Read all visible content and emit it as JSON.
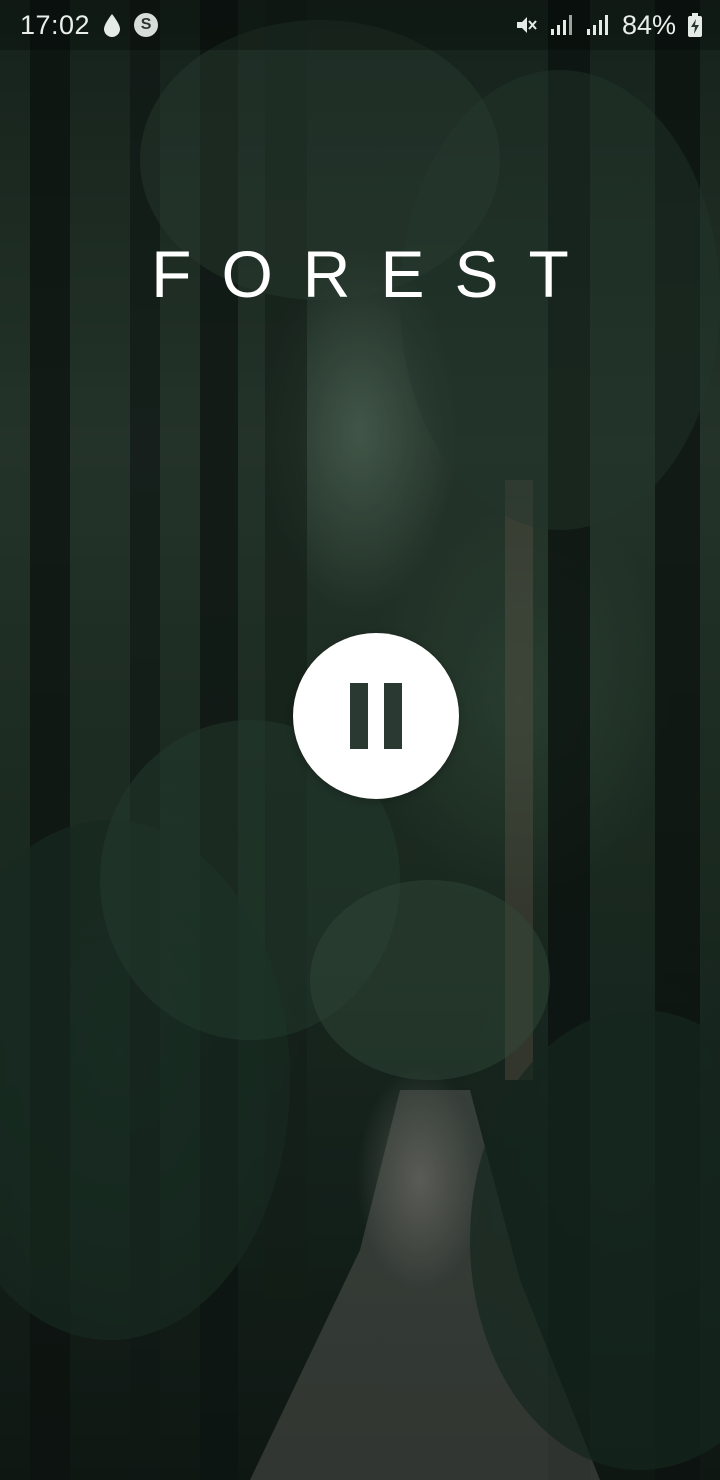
{
  "status_bar": {
    "time": "17:02",
    "battery_percent": "84%",
    "icons": [
      "water-drop-icon",
      "shazam-icon",
      "mute-icon",
      "signal-icon",
      "signal-icon",
      "battery-charging-icon"
    ]
  },
  "main": {
    "title": "FOREST",
    "play_state_button": {
      "icon": "pause-icon",
      "state": "playing"
    }
  },
  "colors": {
    "title_text": "#ffffff",
    "button_background": "#ffffff",
    "pause_bars": "#2a3a33"
  }
}
